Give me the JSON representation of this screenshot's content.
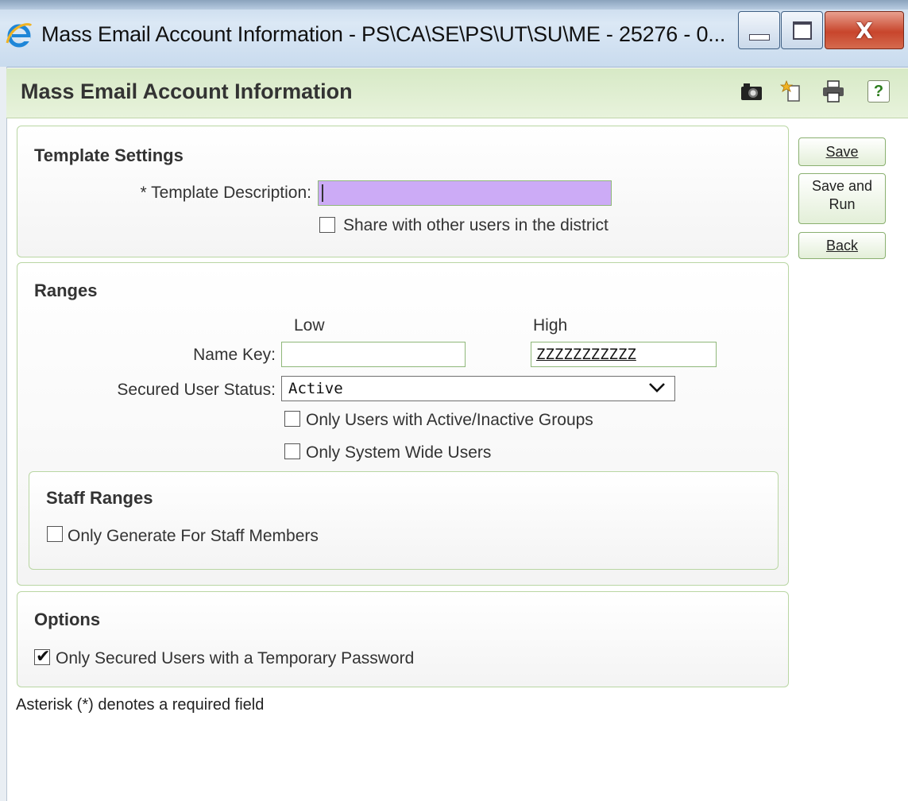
{
  "window": {
    "title": "Mass Email Account Information - PS\\CA\\SE\\PS\\UT\\SU\\ME - 25276 - 0...",
    "buttons": {
      "close_label": "X"
    }
  },
  "header": {
    "title": "Mass Email Account Information",
    "icons": [
      "camera-icon",
      "new-page-icon",
      "print-icon",
      "help-icon"
    ],
    "help_label": "?"
  },
  "actions": {
    "save": "Save",
    "save_and_run_line1": "Save and",
    "save_and_run_line2": "Run",
    "back": "Back"
  },
  "template_settings": {
    "title": "Template Settings",
    "description_label": "* Template Description:",
    "description_value": "",
    "share_label": "Share with other users in the district",
    "share_checked": false
  },
  "ranges": {
    "title": "Ranges",
    "low_header": "Low",
    "high_header": "High",
    "name_key_label": "Name Key:",
    "name_key_low": "",
    "name_key_high": "ZZZZZZZZZZZ",
    "status_label": "Secured User Status:",
    "status_value": "Active",
    "active_groups_label": "Only Users with Active/Inactive Groups",
    "active_groups_checked": false,
    "system_wide_label": "Only System Wide Users",
    "system_wide_checked": false,
    "staff": {
      "title": "Staff Ranges",
      "staff_only_label": "Only Generate For Staff Members",
      "staff_only_checked": false
    }
  },
  "options": {
    "title": "Options",
    "temp_password_label": "Only Secured Users with a Temporary Password",
    "temp_password_checked": true
  },
  "footnote": "Asterisk (*) denotes a required field",
  "colors": {
    "header_green": "#d7e9c6",
    "panel_border": "#b9d6a3",
    "required_field": "#ccabf6",
    "close_button": "#c8452c"
  }
}
